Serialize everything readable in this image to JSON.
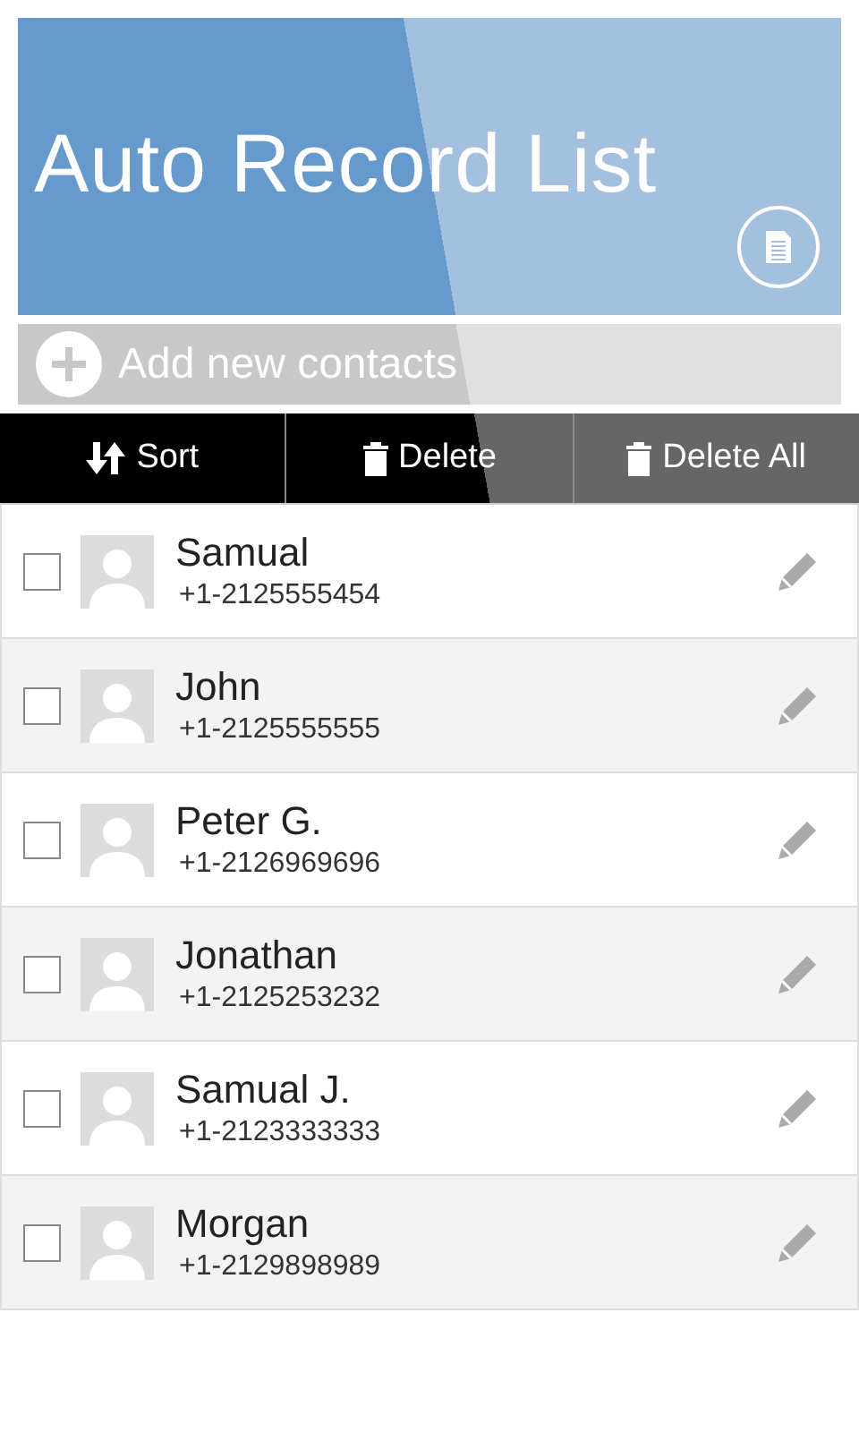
{
  "header": {
    "title": "Auto Record List"
  },
  "add_button": {
    "label": "Add new contacts"
  },
  "toolbar": [
    {
      "kind": "sort",
      "label": "Sort"
    },
    {
      "kind": "delete",
      "label": "Delete"
    },
    {
      "kind": "delete",
      "label": "Delete All"
    }
  ],
  "contacts": [
    {
      "name": "Samual",
      "phone": "+1-2125555454",
      "checked": false
    },
    {
      "name": "John",
      "phone": "+1-2125555555",
      "checked": false
    },
    {
      "name": "Peter G.",
      "phone": "+1-2126969696",
      "checked": false
    },
    {
      "name": "Jonathan",
      "phone": "+1-2125253232",
      "checked": false
    },
    {
      "name": "Samual J.",
      "phone": "+1-2123333333",
      "checked": false
    },
    {
      "name": "Morgan",
      "phone": "+1-2129898989",
      "checked": false
    }
  ]
}
